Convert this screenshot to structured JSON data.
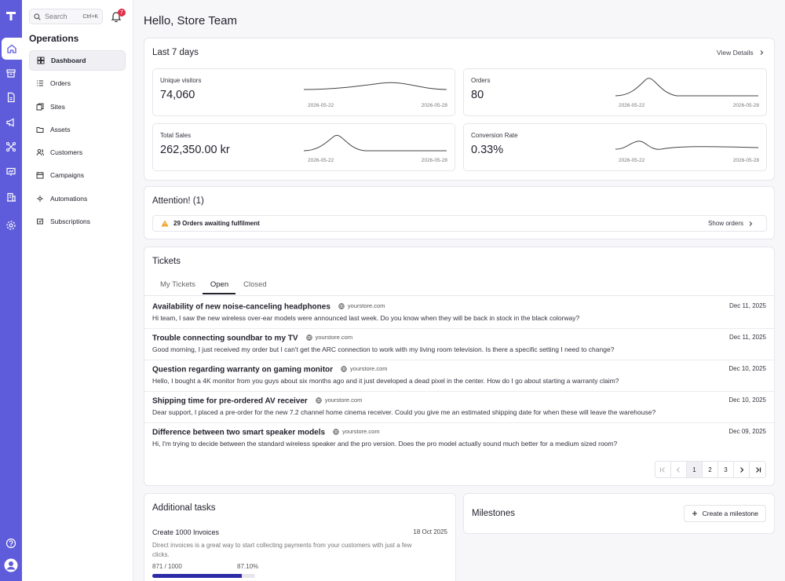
{
  "sidebar": {
    "search_placeholder": "Search",
    "search_shortcut": "Ctrl+K",
    "notification_count": "7",
    "section_title": "Operations",
    "items": [
      {
        "label": "Dashboard",
        "icon": "dashboard-icon",
        "active": true
      },
      {
        "label": "Orders",
        "icon": "list-icon"
      },
      {
        "label": "Sites",
        "icon": "pages-icon"
      },
      {
        "label": "Assets",
        "icon": "folder-icon"
      },
      {
        "label": "Customers",
        "icon": "users-icon"
      },
      {
        "label": "Campaigns",
        "icon": "calendar-icon"
      },
      {
        "label": "Automations",
        "icon": "automation-icon"
      },
      {
        "label": "Subscriptions",
        "icon": "subscription-icon"
      }
    ]
  },
  "header": {
    "greeting": "Hello, Store Team"
  },
  "last7": {
    "title": "Last 7 days",
    "view_details": "View Details",
    "metrics": [
      {
        "label": "Unique visitors",
        "value": "74,060",
        "date_start": "2026-05-22",
        "date_end": "2026-05-28"
      },
      {
        "label": "Orders",
        "value": "80",
        "date_start": "2026-05-22",
        "date_end": "2026-05-28"
      },
      {
        "label": "Total Sales",
        "value": "262,350.00 kr",
        "date_start": "2026-05-22",
        "date_end": "2026-05-28"
      },
      {
        "label": "Conversion Rate",
        "value": "0.33%",
        "date_start": "2026-05-22",
        "date_end": "2026-05-28"
      }
    ]
  },
  "attention": {
    "title": "Attention! (1)",
    "alert_text": "29 Orders awaiting fulfilment",
    "action": "Show orders"
  },
  "tickets": {
    "title": "Tickets",
    "tabs": [
      "My Tickets",
      "Open",
      "Closed"
    ],
    "active_tab": "Open",
    "items": [
      {
        "title": "Availability of new noise-canceling headphones",
        "source": "yourstore.com",
        "date": "Dec 11, 2025",
        "body": "Hi team, I saw the new wireless over-ear models were announced last week. Do you know when they will be back in stock in the black colorway?"
      },
      {
        "title": "Trouble connecting soundbar to my TV",
        "source": "yourstore.com",
        "date": "Dec 11, 2025",
        "body": "Good morning, I just received my order but I can't get the ARC connection to work with my living room television. Is there a specific setting I need to change?"
      },
      {
        "title": "Question regarding warranty on gaming monitor",
        "source": "yourstore.com",
        "date": "Dec 10, 2025",
        "body": "Hello, I bought a 4K monitor from you guys about six months ago and it just developed a dead pixel in the center. How do I go about starting a warranty claim?"
      },
      {
        "title": "Shipping time for pre-ordered AV receiver",
        "source": "yourstore.com",
        "date": "Dec 10, 2025",
        "body": "Dear support, I placed a pre-order for the new 7.2 channel home cinema receiver. Could you give me an estimated shipping date for when these will leave the warehouse?"
      },
      {
        "title": "Difference between two smart speaker models",
        "source": "yourstore.com",
        "date": "Dec 09, 2025",
        "body": "Hi, I'm trying to decide between the standard wireless speaker and the pro version. Does the pro model actually sound much better for a medium sized room?"
      }
    ],
    "pages": [
      "1",
      "2",
      "3"
    ]
  },
  "additional_tasks": {
    "title": "Additional tasks",
    "task_title": "Create 1000 Invoices",
    "date": "18 Oct 2025",
    "description": "Direct invoices is a great way to start collecting payments from your customers with just a few clicks.",
    "count": "871 / 1000",
    "percent": "87.10%",
    "progress": 0.871
  },
  "milestones": {
    "title": "Milestones",
    "button": "Create a milestone"
  },
  "colors": {
    "accent": "#5f5cdb",
    "progress": "#2d2aa7",
    "badge": "#e0304a",
    "warning": "#f0a020"
  }
}
